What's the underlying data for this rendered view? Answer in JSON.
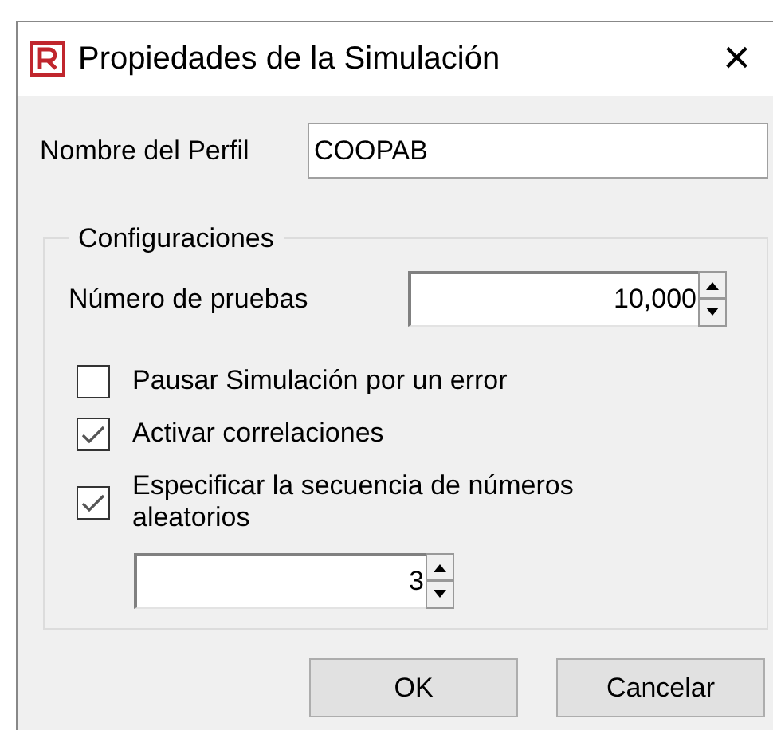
{
  "window": {
    "title": "Propiedades de la Simulación",
    "close": "×"
  },
  "profile": {
    "label": "Nombre del Perfil",
    "value": "COOPAB"
  },
  "group": {
    "title": "Configuraciones",
    "trials": {
      "label": "Número de pruebas",
      "value": "10,000"
    },
    "options": [
      {
        "label": "Pausar Simulación por un error",
        "checked": false
      },
      {
        "label": "Activar correlaciones",
        "checked": true
      },
      {
        "label": "Especificar la secuencia de números aleatorios",
        "checked": true
      }
    ],
    "seed": {
      "value": "3"
    }
  },
  "buttons": [
    {
      "label": "OK"
    },
    {
      "label": "Cancelar"
    }
  ]
}
